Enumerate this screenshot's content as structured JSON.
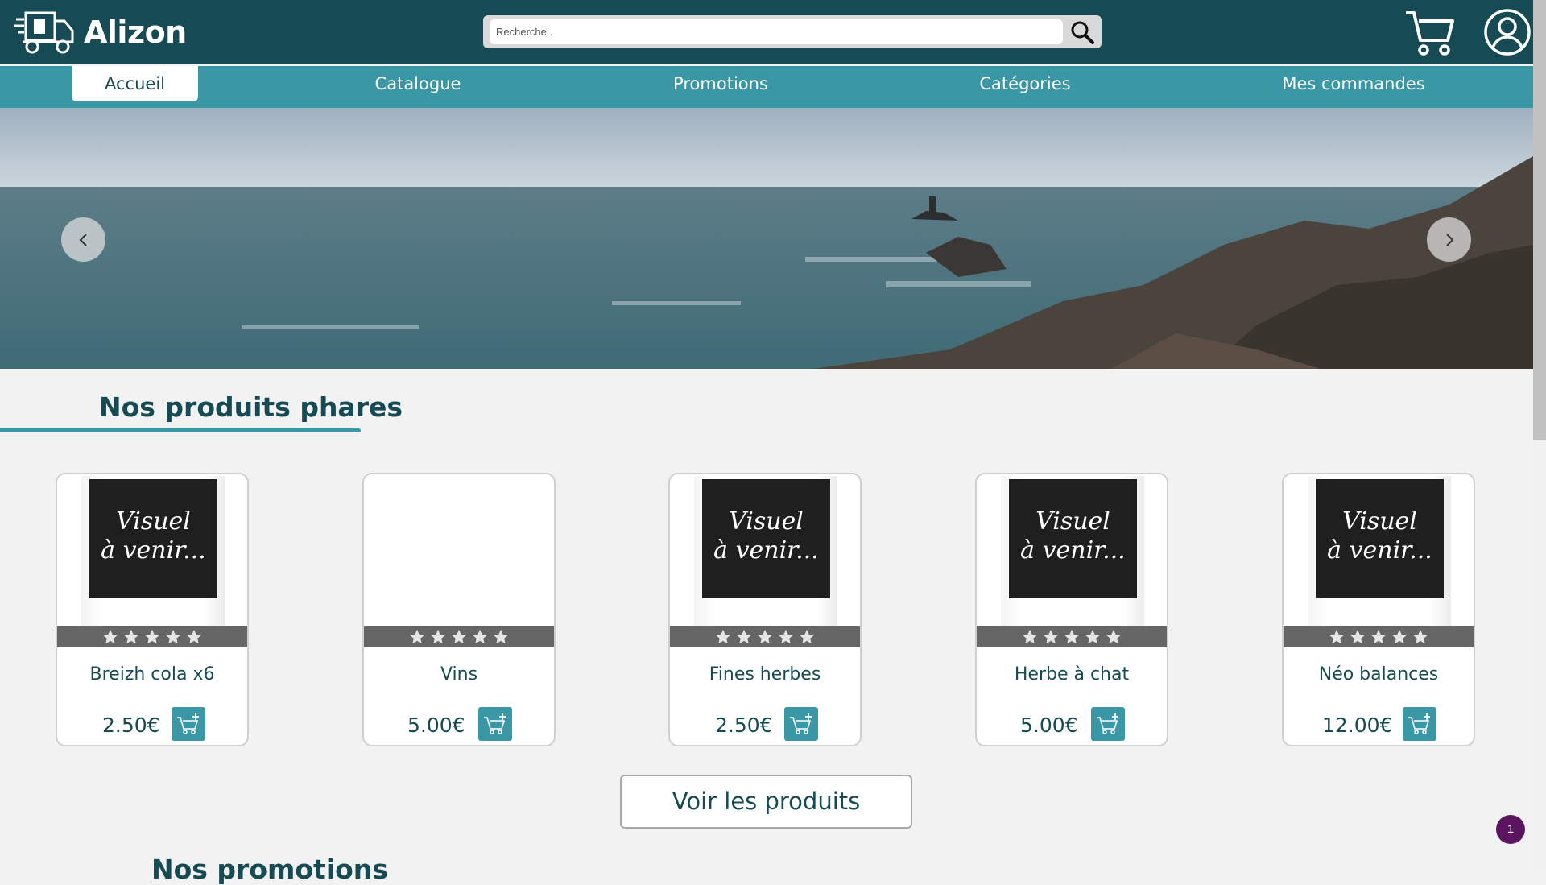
{
  "header": {
    "logo_text": "Alizon",
    "search_placeholder": "Recherche.."
  },
  "nav": {
    "items": [
      {
        "label": "Accueil",
        "active": true
      },
      {
        "label": "Catalogue",
        "active": false
      },
      {
        "label": "Promotions",
        "active": false
      },
      {
        "label": "Catégories",
        "active": false
      },
      {
        "label": "Mes commandes",
        "active": false
      }
    ]
  },
  "featured": {
    "title": "Nos produits phares",
    "products": [
      {
        "name": "Breizh cola x6",
        "price": "2.50€",
        "visual": "Visuel à venir...",
        "rating": 0
      },
      {
        "name": "Vins",
        "price": "5.00€",
        "visual": "",
        "rating": 0
      },
      {
        "name": "Fines herbes",
        "price": "2.50€",
        "visual": "Visuel à venir...",
        "rating": 0
      },
      {
        "name": "Herbe à chat",
        "price": "5.00€",
        "visual": "Visuel à venir...",
        "rating": 0
      },
      {
        "name": "Néo balances",
        "price": "12.00€",
        "visual": "Visuel à venir...",
        "rating": 0
      }
    ],
    "visual_line1": "Visuel",
    "visual_line2": "à venir...",
    "see_products_label": "Voir les produits"
  },
  "promotions": {
    "title": "Nos promotions"
  },
  "notification_badge": "1",
  "colors": {
    "header_bg": "#164b55",
    "nav_bg": "#3a97a6",
    "accent": "#3a97a6",
    "text_dark": "#164b55",
    "page_bg": "#f2f2f2"
  },
  "icons": {
    "logo": "delivery-truck-icon",
    "search": "search-icon",
    "cart": "cart-icon",
    "user": "user-icon",
    "prev": "chevron-left-icon",
    "next": "chevron-right-icon",
    "star": "star-icon",
    "add_to_cart": "cart-plus-icon"
  }
}
